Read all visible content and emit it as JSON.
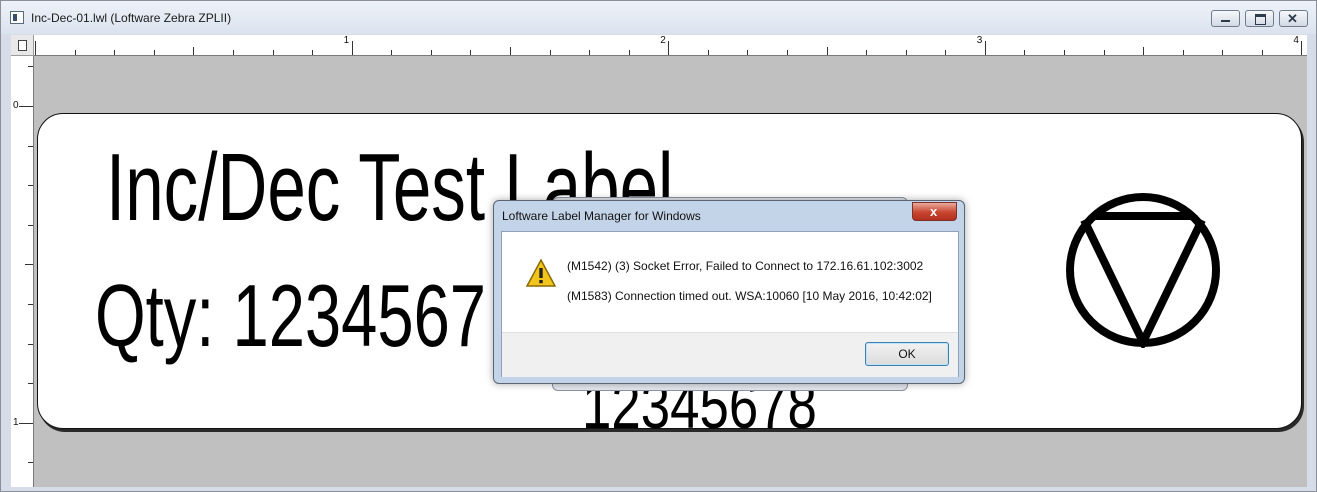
{
  "window": {
    "title": "Inc-Dec-01.lwl (Loftware Zebra ZPLII)",
    "app_icon": "label-document-icon",
    "controls": {
      "minimize_icon": "minimize-icon",
      "maximize_icon": "maximize-icon",
      "close_icon": "close-icon",
      "close_glyph": "✕"
    }
  },
  "rulers": {
    "horizontal_labels": [
      "1",
      "2",
      "3",
      "4"
    ],
    "vertical_labels": [
      "0",
      "1"
    ]
  },
  "label": {
    "title": "Inc/Dec Test Label",
    "qty": "Qty: 1234567",
    "code": "12345678",
    "symbol_icon": "circle-triangle-icon"
  },
  "dialog": {
    "title": "Loftware Label Manager for Windows",
    "close_glyph": "x",
    "warning_icon": "warning-icon",
    "message_line1": "(M1542) (3) Socket Error, Failed to Connect to 172.16.61.102:3002",
    "message_line2": "(M1583) Connection timed out.  WSA:10060 [10 May 2016, 10:42:02]",
    "ok_label": "OK"
  },
  "colors": {
    "workspace": "#c0c0c0",
    "dialog_frame": "#c4d4e8",
    "close_red": "#c8452f",
    "warning_yellow": "#f2c51c"
  }
}
